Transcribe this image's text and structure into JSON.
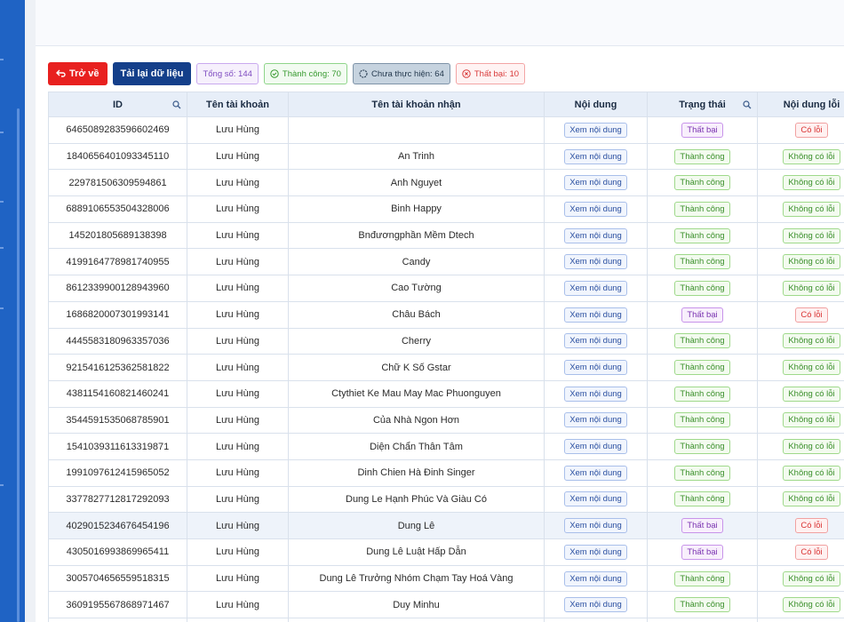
{
  "toolbar": {
    "back_label": "Trở về",
    "reload_label": "Tải lại dữ liệu",
    "total_label": "Tổng số: 144",
    "success_label": "Thành công: 70",
    "pending_label": "Chưa thực hiện: 64",
    "failed_label": "Thất bại: 10"
  },
  "table": {
    "columns": [
      "ID",
      "Tên tài khoản",
      "Tên tài khoản nhận",
      "Nội dung",
      "Trạng thái",
      "Nội dung lỗi"
    ],
    "rows": [
      {
        "id": "6465089283596602469",
        "account": "Lưu Hùng",
        "receiver": "",
        "content": "Xem nội dung",
        "status": "Thất bại",
        "error": "Có lỗi"
      },
      {
        "id": "1840656401093345110",
        "account": "Lưu Hùng",
        "receiver": "An Trinh",
        "content": "Xem nội dung",
        "status": "Thành công",
        "error": "Không có lỗi"
      },
      {
        "id": "2297815063095948​61",
        "account": "Lưu Hùng",
        "receiver": "Anh Nguyet",
        "content": "Xem nội dung",
        "status": "Thành công",
        "error": "Không có lỗi"
      },
      {
        "id": "6889106553504328006",
        "account": "Lưu Hùng",
        "receiver": "Binh Happy",
        "content": "Xem nội dung",
        "status": "Thành công",
        "error": "Không có lỗi"
      },
      {
        "id": "1452018056891383​98",
        "account": "Lưu Hùng",
        "receiver": "Bnđươngphần Mềm Dtech",
        "content": "Xem nội dung",
        "status": "Thành công",
        "error": "Không có lỗi"
      },
      {
        "id": "4199164778981740955",
        "account": "Lưu Hùng",
        "receiver": "Candy",
        "content": "Xem nội dung",
        "status": "Thành công",
        "error": "Không có lỗi"
      },
      {
        "id": "8612339900128943960",
        "account": "Lưu Hùng",
        "receiver": "Cao Tường",
        "content": "Xem nội dung",
        "status": "Thành công",
        "error": "Không có lỗi"
      },
      {
        "id": "1686820007301993141",
        "account": "Lưu Hùng",
        "receiver": "Châu Bách",
        "content": "Xem nội dung",
        "status": "Thất bại",
        "error": "Có lỗi"
      },
      {
        "id": "4445583180963357036",
        "account": "Lưu Hùng",
        "receiver": "Cherry",
        "content": "Xem nội dung",
        "status": "Thành công",
        "error": "Không có lỗi"
      },
      {
        "id": "9215416125362581822",
        "account": "Lưu Hùng",
        "receiver": "Chữ K Số Gstar",
        "content": "Xem nội dung",
        "status": "Thành công",
        "error": "Không có lỗi"
      },
      {
        "id": "4381154160821460241",
        "account": "Lưu Hùng",
        "receiver": "Ctythiet Ke Mau May Mac Phuonguyen",
        "content": "Xem nội dung",
        "status": "Thành công",
        "error": "Không có lỗi"
      },
      {
        "id": "3544591535068785901",
        "account": "Lưu Hùng",
        "receiver": "Của Nhà Ngon Hơn",
        "content": "Xem nội dung",
        "status": "Thành công",
        "error": "Không có lỗi"
      },
      {
        "id": "1541039311613319871",
        "account": "Lưu Hùng",
        "receiver": "Diện Chẩn Thân Tâm",
        "content": "Xem nội dung",
        "status": "Thành công",
        "error": "Không có lỗi"
      },
      {
        "id": "1991097612415965052",
        "account": "Lưu Hùng",
        "receiver": "Dinh Chien Hà Đinh Singer",
        "content": "Xem nội dung",
        "status": "Thành công",
        "error": "Không có lỗi"
      },
      {
        "id": "3377827712817292093",
        "account": "Lưu Hùng",
        "receiver": "Dung Le Hạnh Phúc Và Giàu Có",
        "content": "Xem nội dung",
        "status": "Thành công",
        "error": "Không có lỗi"
      },
      {
        "id": "4029015234676454196",
        "account": "Lưu Hùng",
        "receiver": "Dung Lê",
        "content": "Xem nội dung",
        "status": "Thất bại",
        "error": "Có lỗi"
      },
      {
        "id": "4305016993869965411",
        "account": "Lưu Hùng",
        "receiver": "Dung Lê Luật Hấp Dẫn",
        "content": "Xem nội dung",
        "status": "Thất bại",
        "error": "Có lỗi"
      },
      {
        "id": "3005704656559518315",
        "account": "Lưu Hùng",
        "receiver": "Dung Lê Trưởng Nhóm Chạm Tay Hoá Vàng",
        "content": "Xem nội dung",
        "status": "Thành công",
        "error": "Không có lỗi"
      },
      {
        "id": "3609195567868971467",
        "account": "Lưu Hùng",
        "receiver": "Duy Minhu",
        "content": "Xem nội dung",
        "status": "Thành công",
        "error": "Không có lỗi"
      },
      {
        "id": "",
        "account": "",
        "receiver": "",
        "content": "",
        "status": "",
        "error": ""
      }
    ]
  }
}
